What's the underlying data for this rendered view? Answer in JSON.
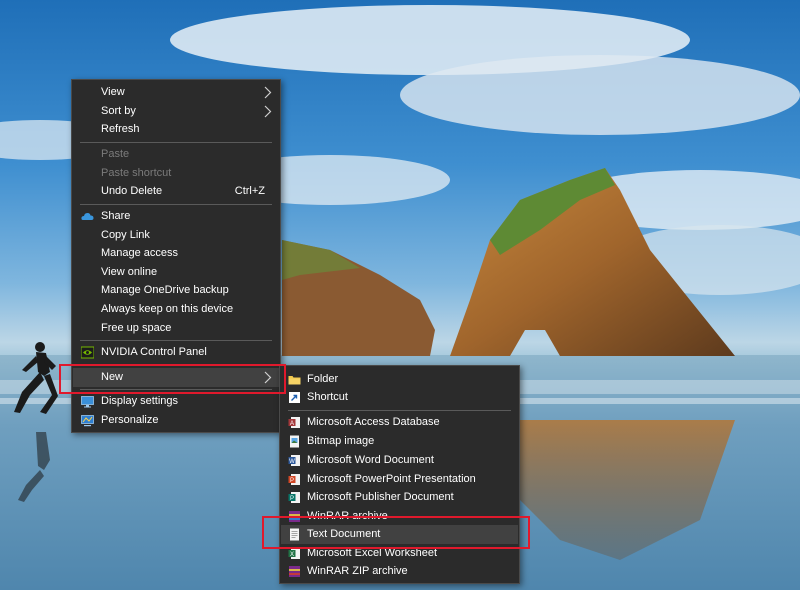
{
  "context_menu": {
    "items": {
      "view": "View",
      "sort_by": "Sort by",
      "refresh": "Refresh",
      "paste": "Paste",
      "paste_shortcut": "Paste shortcut",
      "undo_delete": "Undo Delete",
      "undo_delete_shortcut": "Ctrl+Z",
      "share": "Share",
      "copy_link": "Copy Link",
      "manage_access": "Manage access",
      "view_online": "View online",
      "manage_onedrive_backup": "Manage OneDrive backup",
      "always_keep": "Always keep on this device",
      "free_up_space": "Free up space",
      "nvidia": "NVIDIA Control Panel",
      "new": "New",
      "display_settings": "Display settings",
      "personalize": "Personalize"
    }
  },
  "new_submenu": {
    "items": {
      "folder": "Folder",
      "shortcut": "Shortcut",
      "access": "Microsoft Access Database",
      "bitmap": "Bitmap image",
      "word": "Microsoft Word Document",
      "powerpoint": "Microsoft PowerPoint Presentation",
      "publisher": "Microsoft Publisher Document",
      "winrar": "WinRAR archive",
      "text": "Text Document",
      "excel": "Microsoft Excel Worksheet",
      "winrar_zip": "WinRAR ZIP archive"
    }
  },
  "colors": {
    "menu_bg": "#2b2b2b",
    "highlight_red": "#e0192c",
    "disabled_text": "#7b7b7b"
  }
}
